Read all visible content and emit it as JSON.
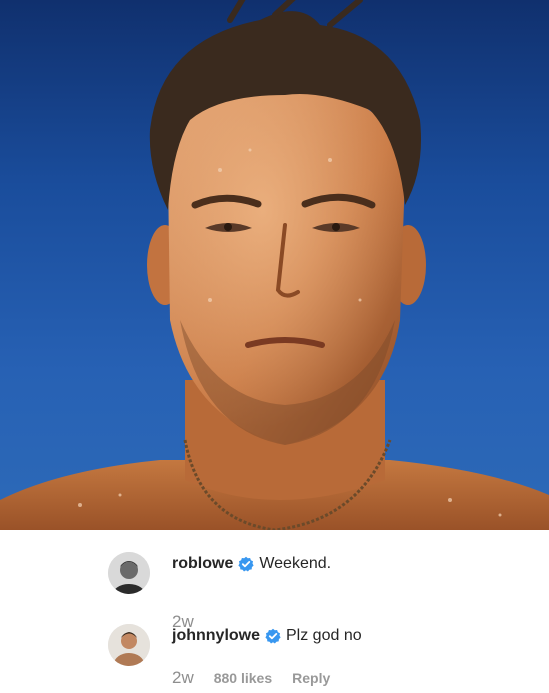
{
  "post": {
    "image_alt": "Sunlit close-up selfie of a shirtless man with wet hair against a clear blue sky"
  },
  "comments": [
    {
      "username": "roblowe",
      "verified": true,
      "text": "Weekend.",
      "time": "2w",
      "likes": "",
      "reply": ""
    },
    {
      "username": "johnnylowe",
      "verified": true,
      "text": "Plz god no",
      "time": "2w",
      "likes": "880 likes",
      "reply": "Reply"
    }
  ],
  "colors": {
    "verified_badge": "#3897f0",
    "sky_top": "#10306e",
    "sky_bottom": "#2d6ab8",
    "meta_text": "#8e8e8e"
  },
  "icons": {
    "verified": "verified-badge-icon"
  }
}
